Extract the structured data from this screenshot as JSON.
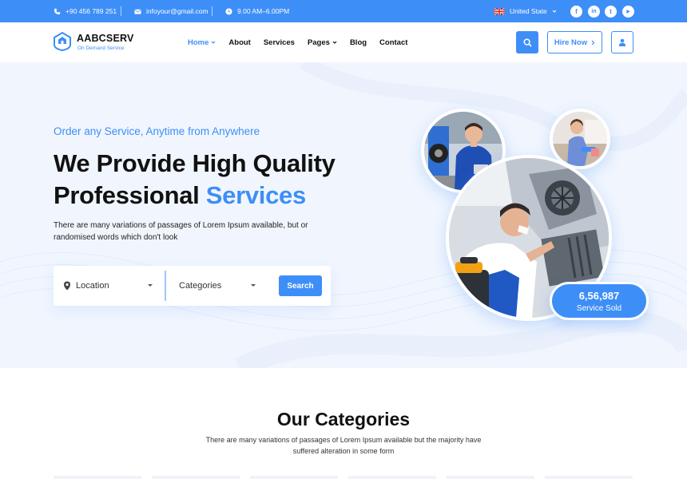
{
  "topbar": {
    "phone": "+90 456 789 251",
    "email": "infoyour@gmail.com",
    "hours": "9.00 AM–6.00PM",
    "country": "United State",
    "socials": [
      {
        "icon": "facebook-icon",
        "glyph": "f"
      },
      {
        "icon": "linkedin-icon",
        "glyph": "in"
      },
      {
        "icon": "twitter-icon",
        "glyph": "t"
      },
      {
        "icon": "youtube-icon",
        "glyph": "▶"
      }
    ]
  },
  "header": {
    "brand": "AABCSERV",
    "tagline": "On Demand Service",
    "nav": [
      {
        "label": "Home",
        "dropdown": true,
        "active": true
      },
      {
        "label": "About",
        "dropdown": false,
        "active": false
      },
      {
        "label": "Services",
        "dropdown": false,
        "active": false
      },
      {
        "label": "Pages",
        "dropdown": true,
        "active": false
      },
      {
        "label": "Blog",
        "dropdown": false,
        "active": false
      },
      {
        "label": "Contact",
        "dropdown": false,
        "active": false
      }
    ],
    "hire_label": "Hire Now"
  },
  "hero": {
    "eyebrow": "Order any Service, Anytime from Anywhere",
    "title_line1": "We Provide High Quality",
    "title_line2_prefix": "Professional ",
    "title_line2_highlight": "Services",
    "description": "There are many variations of passages of Lorem Ipsum available, but or randomised words which don't look",
    "search": {
      "location_label": "Location",
      "categories_label": "Categories",
      "button_label": "Search"
    },
    "stat": {
      "value": "6,56,987",
      "label": "Service Sold"
    }
  },
  "categories": {
    "title": "Our Categories",
    "description": "There are many variations of passages of Lorem Ipsum available but the majority have suffered alteration in some form"
  },
  "colors": {
    "accent": "#3e8ef7",
    "hero_bg": "#f1f6fe",
    "text": "#111111"
  }
}
